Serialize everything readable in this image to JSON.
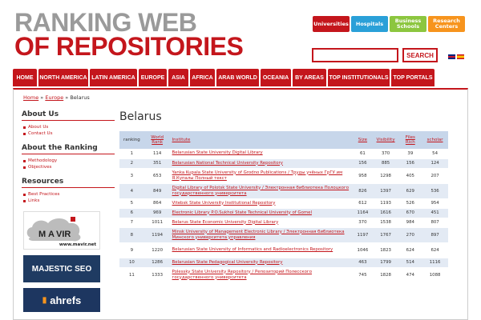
{
  "header": {
    "logo_line1": "RANKING WEB",
    "logo_line2": "OF REPOSITORIES",
    "top_tabs": [
      "Universities",
      "Hospitals",
      "Business Schools",
      "Research Centers"
    ],
    "search_label": "SEARCH"
  },
  "nav": [
    "HOME",
    "NORTH AMERICA",
    "LATIN AMERICA",
    "EUROPE",
    "ASIA",
    "AFRICA",
    "ARAB WORLD",
    "OCEANIA",
    "BY AREAS",
    "TOP INSTITUTIONALS",
    "TOP PORTALS"
  ],
  "breadcrumb": {
    "home": "Home",
    "sep": "»",
    "europe": "Europe",
    "current": "Belarus"
  },
  "sidebar": {
    "about_us": {
      "title": "About Us",
      "items": [
        "About Us",
        "Contact Us"
      ]
    },
    "about_ranking": {
      "title": "About the Ranking",
      "items": [
        "Methodology",
        "Objectives"
      ]
    },
    "resources": {
      "title": "Resources",
      "items": [
        "Best Practices",
        "Links"
      ]
    },
    "banners": {
      "mavir_url": "www.mavir.net",
      "majestic": "MAJESTIC SEO",
      "ahrefs": "ahrefs"
    }
  },
  "main": {
    "country": "Belarus",
    "columns": [
      "ranking",
      "World Rank",
      "Institute",
      "Size",
      "Visibility",
      "Files Rich",
      "scholar"
    ],
    "rows": [
      {
        "rank": "1",
        "world": "114",
        "name": "Belarusian State University Digital Library",
        "size": "61",
        "vis": "370",
        "files": "39",
        "scholar": "54"
      },
      {
        "rank": "2",
        "world": "351",
        "name": "Belarusian National Technical University Repository",
        "size": "156",
        "vis": "885",
        "files": "156",
        "scholar": "124"
      },
      {
        "rank": "3",
        "world": "653",
        "name": "Yanka Kupala State University of Grodno Publications / Труды учёных ГрГУ им Я.Купалы Полный текст",
        "size": "958",
        "vis": "1298",
        "files": "405",
        "scholar": "207"
      },
      {
        "rank": "4",
        "world": "849",
        "name": "Digital Library of Polotsk State University / Электронная библиотека Полоцкого государственного университета",
        "size": "826",
        "vis": "1397",
        "files": "629",
        "scholar": "536"
      },
      {
        "rank": "5",
        "world": "864",
        "name": "Vitebsk State University Institutional Repository",
        "size": "612",
        "vis": "1193",
        "files": "526",
        "scholar": "954"
      },
      {
        "rank": "6",
        "world": "969",
        "name": "Electronic Library P.O.Sukhoi State Technical University of Gomel",
        "size": "1164",
        "vis": "1616",
        "files": "670",
        "scholar": "451"
      },
      {
        "rank": "7",
        "world": "1011",
        "name": "Belarus State Economic University Digital Library",
        "size": "370",
        "vis": "1538",
        "files": "984",
        "scholar": "807"
      },
      {
        "rank": "8",
        "world": "1194",
        "name": "Minsk University of Management Electronic Library / Электронная библиотека Минского университета управления",
        "size": "1197",
        "vis": "1767",
        "files": "270",
        "scholar": "897"
      },
      {
        "rank": "9",
        "world": "1220",
        "name": "Belarusian State University of Informatics and Radioelectronics Repository",
        "size": "1046",
        "vis": "1823",
        "files": "624",
        "scholar": "624"
      },
      {
        "rank": "10",
        "world": "1286",
        "name": "Belarusian State Pedagogical University Repository",
        "size": "463",
        "vis": "1799",
        "files": "514",
        "scholar": "1116"
      },
      {
        "rank": "11",
        "world": "1333",
        "name": "Polessky State University Repository / Репозиторий Полесского государственного университета",
        "size": "745",
        "vis": "1828",
        "files": "474",
        "scholar": "1088"
      }
    ]
  },
  "colors": {
    "brand_red": "#c4161c",
    "header_blue": "#c7d6ea",
    "row_alt": "#e3eaf4"
  }
}
